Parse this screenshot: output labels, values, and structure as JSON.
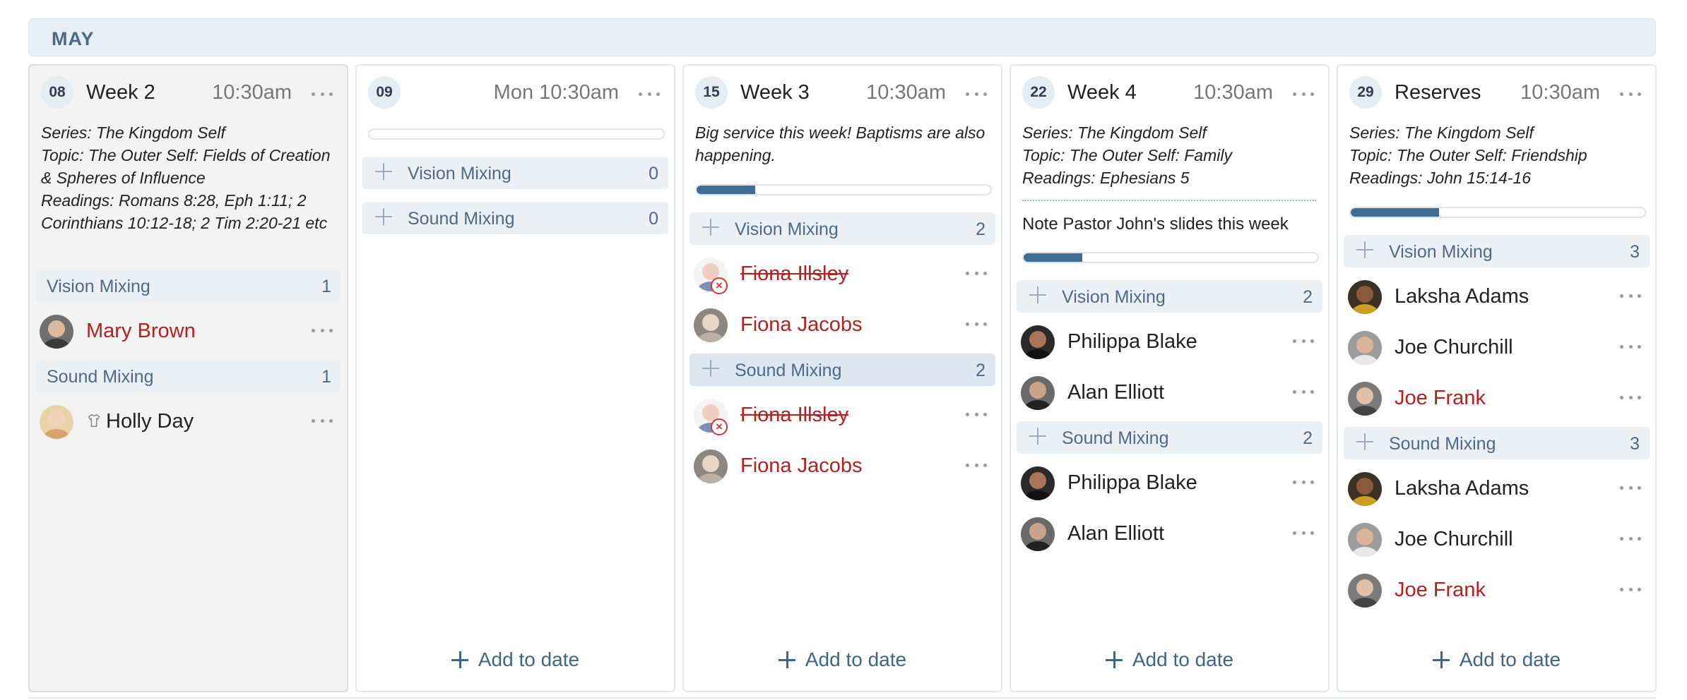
{
  "month": "MAY",
  "add_label": "Add to date",
  "colors": {
    "accent": "#3f6588",
    "progress": "#3e6c94",
    "section_bg": "#ebf0f5",
    "declined_red": "#b22222"
  },
  "icons": {
    "more": "more-icon",
    "add": "plus-icon",
    "declined": "declined-icon",
    "shirt": "shirt-icon"
  },
  "columns": [
    {
      "day": "08",
      "title": "Week 2",
      "time": "10:30am",
      "notes": [
        "Series: The Kingdom Self",
        "Topic: The Outer Self: Fields of Creation & Spheres of Influence",
        "Readings: Romans 8:28, Eph 1:11; 2 Corinthians 10:12-18; 2 Tim 2:20-21 etc"
      ],
      "sections": [
        {
          "label": "Vision Mixing",
          "count": "1",
          "people": [
            {
              "name": "Mary Brown",
              "status": "unconfirmed"
            }
          ]
        },
        {
          "label": "Sound Mixing",
          "count": "1",
          "people": [
            {
              "name": "Holly Day",
              "status": "confirmed"
            }
          ]
        }
      ]
    },
    {
      "day": "09",
      "title": "",
      "time": "Mon 10:30am",
      "progress": 0,
      "sections": [
        {
          "label": "Vision Mixing",
          "count": "0",
          "people": []
        },
        {
          "label": "Sound Mixing",
          "count": "0",
          "people": []
        }
      ]
    },
    {
      "day": "15",
      "title": "Week 3",
      "time": "10:30am",
      "notes": [
        "Big service this week! Baptisms are also happening."
      ],
      "progress": 0.2,
      "sections": [
        {
          "label": "Vision Mixing",
          "count": "2",
          "people": [
            {
              "name": "Fiona Illsley",
              "status": "declined"
            },
            {
              "name": "Fiona Jacobs",
              "status": "unconfirmed"
            }
          ]
        },
        {
          "label": "Sound Mixing",
          "count": "2",
          "people": [
            {
              "name": "Fiona Illsley",
              "status": "declined"
            },
            {
              "name": "Fiona Jacobs",
              "status": "unconfirmed"
            }
          ]
        }
      ]
    },
    {
      "day": "22",
      "title": "Week 4",
      "time": "10:30am",
      "notes": [
        "Series: The Kingdom Self",
        "Topic: The Outer Self: Family",
        "Readings: Ephesians 5"
      ],
      "extra_note": "Note Pastor John's slides this week",
      "progress": 0.2,
      "sections": [
        {
          "label": "Vision Mixing",
          "count": "2",
          "people": [
            {
              "name": "Philippa Blake",
              "status": "confirmed"
            },
            {
              "name": "Alan Elliott",
              "status": "confirmed"
            }
          ]
        },
        {
          "label": "Sound Mixing",
          "count": "2",
          "people": [
            {
              "name": "Philippa Blake",
              "status": "confirmed"
            },
            {
              "name": "Alan Elliott",
              "status": "confirmed"
            }
          ]
        }
      ]
    },
    {
      "day": "29",
      "title": "Reserves",
      "time": "10:30am",
      "notes": [
        "Series: The Kingdom Self",
        "Topic: The Outer Self: Friendship",
        "Readings: John 15:14-16"
      ],
      "progress": 0.3,
      "sections": [
        {
          "label": "Vision Mixing",
          "count": "3",
          "people": [
            {
              "name": "Laksha Adams",
              "status": "confirmed"
            },
            {
              "name": "Joe Churchill",
              "status": "confirmed"
            },
            {
              "name": "Joe Frank",
              "status": "unconfirmed"
            }
          ]
        },
        {
          "label": "Sound Mixing",
          "count": "3",
          "people": [
            {
              "name": "Laksha Adams",
              "status": "confirmed"
            },
            {
              "name": "Joe Churchill",
              "status": "confirmed"
            },
            {
              "name": "Joe Frank",
              "status": "unconfirmed"
            }
          ]
        }
      ]
    }
  ]
}
